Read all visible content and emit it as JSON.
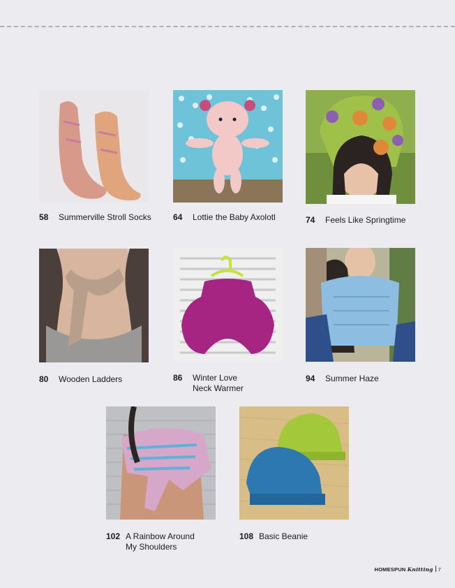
{
  "patterns": [
    {
      "page": "58",
      "title_lines": [
        "Summerville Stroll Socks"
      ]
    },
    {
      "page": "64",
      "title_lines": [
        "Lottie the Baby Axolotl"
      ]
    },
    {
      "page": "74",
      "title_lines": [
        "Feels Like Springtime"
      ]
    },
    {
      "page": "80",
      "title_lines": [
        "Wooden Ladders"
      ]
    },
    {
      "page": "86",
      "title_lines": [
        "Winter Love",
        "Neck Warmer"
      ]
    },
    {
      "page": "94",
      "title_lines": [
        "Summer Haze"
      ]
    },
    {
      "page": "102",
      "title_lines": [
        "A Rainbow Around",
        "My Shoulders"
      ]
    },
    {
      "page": "108",
      "title_lines": [
        "Basic Beanie"
      ]
    }
  ],
  "footer": {
    "brand": "HOMESPUN",
    "brand_script": "Knitting",
    "page_number": "7"
  },
  "colors": {
    "background": "#ecebef",
    "dashed_rule": "#a9b0c4"
  }
}
